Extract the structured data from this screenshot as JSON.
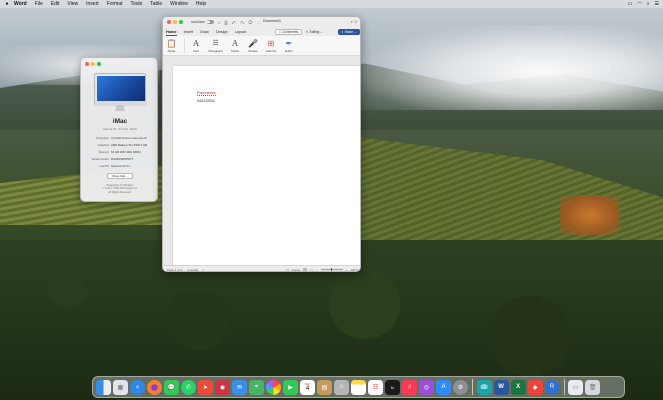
{
  "menubar": {
    "app_name": "Word",
    "menus": [
      "File",
      "Edit",
      "View",
      "Insert",
      "Format",
      "Tools",
      "Table",
      "Window",
      "Help"
    ]
  },
  "about_mac": {
    "model": "iMac",
    "model_sub": "Retina 5K, 27-inch, 2020",
    "specs": [
      {
        "k": "Processor",
        "v": "3.1 GHz 6-Core Intel Core i5"
      },
      {
        "k": "Graphics",
        "v": "AMD Radeon Pro 5300 4 GB"
      },
      {
        "k": "Memory",
        "v": "64 GB 2667 MHz DDR4"
      },
      {
        "k": "Serial number",
        "v": "DGKDK0PKPN77"
      },
      {
        "k": "macOS",
        "v": "Sonoma 14.6.1"
      }
    ],
    "more_info": "More Info...",
    "legal": "Regulatory Certification\n™ and © 1983-2024 Apple Inc.\nAll Rights Reserved."
  },
  "word": {
    "autosave_label": "AutoSave",
    "doc_title": "Document1",
    "tabs": [
      "Home",
      "Insert",
      "Draw",
      "Design",
      "Layout"
    ],
    "comments_label": "Comments",
    "editing_label": "Editing",
    "share_label": "Share",
    "ribbon": [
      {
        "label": "Paste",
        "icon": "clipboard-icon"
      },
      {
        "label": "Font",
        "icon": "font-icon"
      },
      {
        "label": "Paragraph",
        "icon": "paragraph-icon"
      },
      {
        "label": "Styles",
        "icon": "styles-icon"
      },
      {
        "label": "Dictate",
        "icon": "microphone-icon"
      },
      {
        "label": "Add-ins",
        "icon": "add-ins-icon"
      },
      {
        "label": "Editor",
        "icon": "editor-icon"
      }
    ],
    "doc_line1": "Ramassss",
    "doc_line2": "04/12/2024",
    "status_page": "Page 1 of 1",
    "status_words": "2 words",
    "status_focus": "Focus",
    "zoom": "120%"
  },
  "dock": {
    "apps": [
      {
        "name": "finder-icon",
        "color": "#3a8ee6"
      },
      {
        "name": "launchpad-icon",
        "color": "#e0e4ea"
      },
      {
        "name": "safari-icon",
        "color": "#2e87e8"
      },
      {
        "name": "firefox-icon",
        "color": "#ff7a2c"
      },
      {
        "name": "messages-icon",
        "color": "#36c759"
      },
      {
        "name": "whatsapp-icon",
        "color": "#25d366"
      },
      {
        "name": "maps-arrow-icon",
        "color": "#e94b3c"
      },
      {
        "name": "photo-booth-icon",
        "color": "#cc3344"
      },
      {
        "name": "mail-icon",
        "color": "#3a8ee6"
      },
      {
        "name": "maps-icon",
        "color": "#49b36a"
      },
      {
        "name": "photos-icon",
        "color": "#f4f4f4"
      },
      {
        "name": "facetime-icon",
        "color": "#34c759"
      },
      {
        "name": "calendar-icon",
        "color": "#ffffff"
      },
      {
        "name": "notes-brown-icon",
        "color": "#c79a5c"
      },
      {
        "name": "contacts-icon",
        "color": "#b5b5b5"
      },
      {
        "name": "notes-icon",
        "color": "#ffd94a"
      },
      {
        "name": "reminders-icon",
        "color": "#ffffff"
      },
      {
        "name": "apple-tv-icon",
        "color": "#1a1a1a"
      },
      {
        "name": "music-icon",
        "color": "#fa3b58"
      },
      {
        "name": "podcasts-icon",
        "color": "#9b4fd9"
      },
      {
        "name": "app-store-icon",
        "color": "#2f8cf5"
      },
      {
        "name": "system-settings-icon",
        "color": "#8e8e93"
      },
      {
        "name": "tune-icon",
        "color": "#1aa3a8"
      },
      {
        "name": "word-icon",
        "color": "#2b579a"
      },
      {
        "name": "excel-icon",
        "color": "#1f7244"
      },
      {
        "name": "anydesk-icon",
        "color": "#ef443b"
      },
      {
        "name": "remote-icon",
        "color": "#2f6fd1"
      },
      {
        "name": "document-icon",
        "color": "#e8eaed"
      },
      {
        "name": "trash-icon",
        "color": "#d5d8dc"
      }
    ],
    "calendar_day": "4",
    "calendar_month": "SEP"
  }
}
